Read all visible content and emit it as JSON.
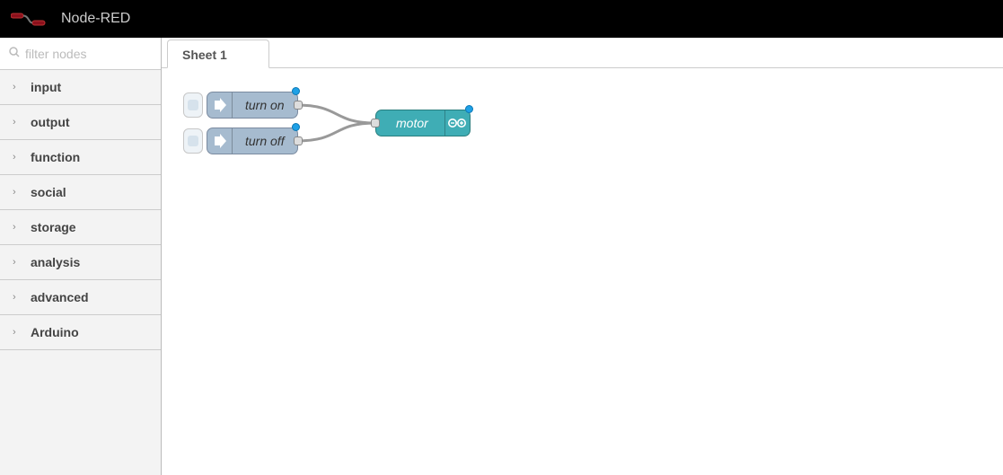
{
  "header": {
    "title": "Node-RED"
  },
  "palette": {
    "search_placeholder": "filter nodes",
    "categories": [
      {
        "label": "input"
      },
      {
        "label": "output"
      },
      {
        "label": "function"
      },
      {
        "label": "social"
      },
      {
        "label": "storage"
      },
      {
        "label": "analysis"
      },
      {
        "label": "advanced"
      },
      {
        "label": "Arduino"
      }
    ]
  },
  "workspace": {
    "tabs": [
      {
        "label": "Sheet 1"
      }
    ],
    "nodes": {
      "inject1": {
        "type": "inject",
        "label": "turn on"
      },
      "inject2": {
        "type": "inject",
        "label": "turn off"
      },
      "arduino1": {
        "type": "arduino-out",
        "label": "motor"
      }
    }
  },
  "colors": {
    "inject_node": "#a6bbcf",
    "arduino_node": "#3fadb5",
    "status_dot": "#1ea0e6",
    "wire": "#999999"
  }
}
